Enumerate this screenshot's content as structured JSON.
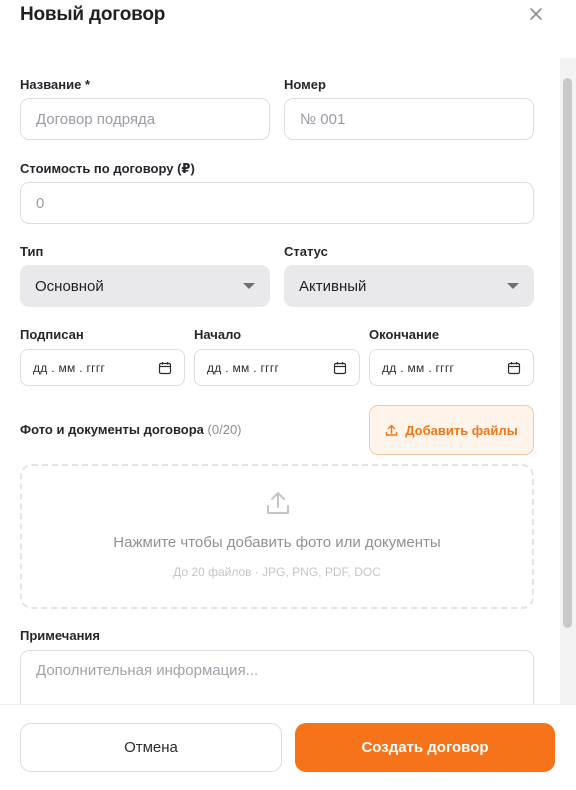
{
  "dialog": {
    "title": "Новый договор",
    "close_icon": "close-icon"
  },
  "form": {
    "name": {
      "label": "Название *",
      "placeholder": "Договор подряда"
    },
    "number": {
      "label": "Номер",
      "placeholder": "№ 001"
    },
    "cost": {
      "label": "Стоимость по договору (₽)",
      "placeholder": "0"
    },
    "type": {
      "label": "Тип",
      "value": "Основной"
    },
    "status": {
      "label": "Статус",
      "value": "Активный"
    },
    "signed": {
      "label": "Подписан",
      "placeholder": "дд . мм . гггг",
      "icon": "calendar-icon"
    },
    "start": {
      "label": "Начало",
      "placeholder": "дд . мм . гггг",
      "icon": "calendar-icon"
    },
    "end": {
      "label": "Окончание",
      "placeholder": "дд . мм . гггг",
      "icon": "calendar-icon"
    },
    "files": {
      "label": "Фото и документы договора",
      "count": "(0/20)",
      "add_button": "Добавить файлы",
      "add_icon": "upload-icon",
      "dropzone_main": "Нажмите чтобы добавить фото или документы",
      "dropzone_sub": "До 20 файлов · JPG, PNG, PDF, DOC",
      "dropzone_icon": "upload-icon"
    },
    "notes": {
      "label": "Примечания",
      "placeholder": "Дополнительная информация..."
    }
  },
  "footer": {
    "cancel_label": "Отмена",
    "create_label": "Создать договор"
  },
  "colors": {
    "accent": "#f7731a",
    "accent_light": "#fff4ea",
    "select_bg": "#e9e9ec"
  }
}
